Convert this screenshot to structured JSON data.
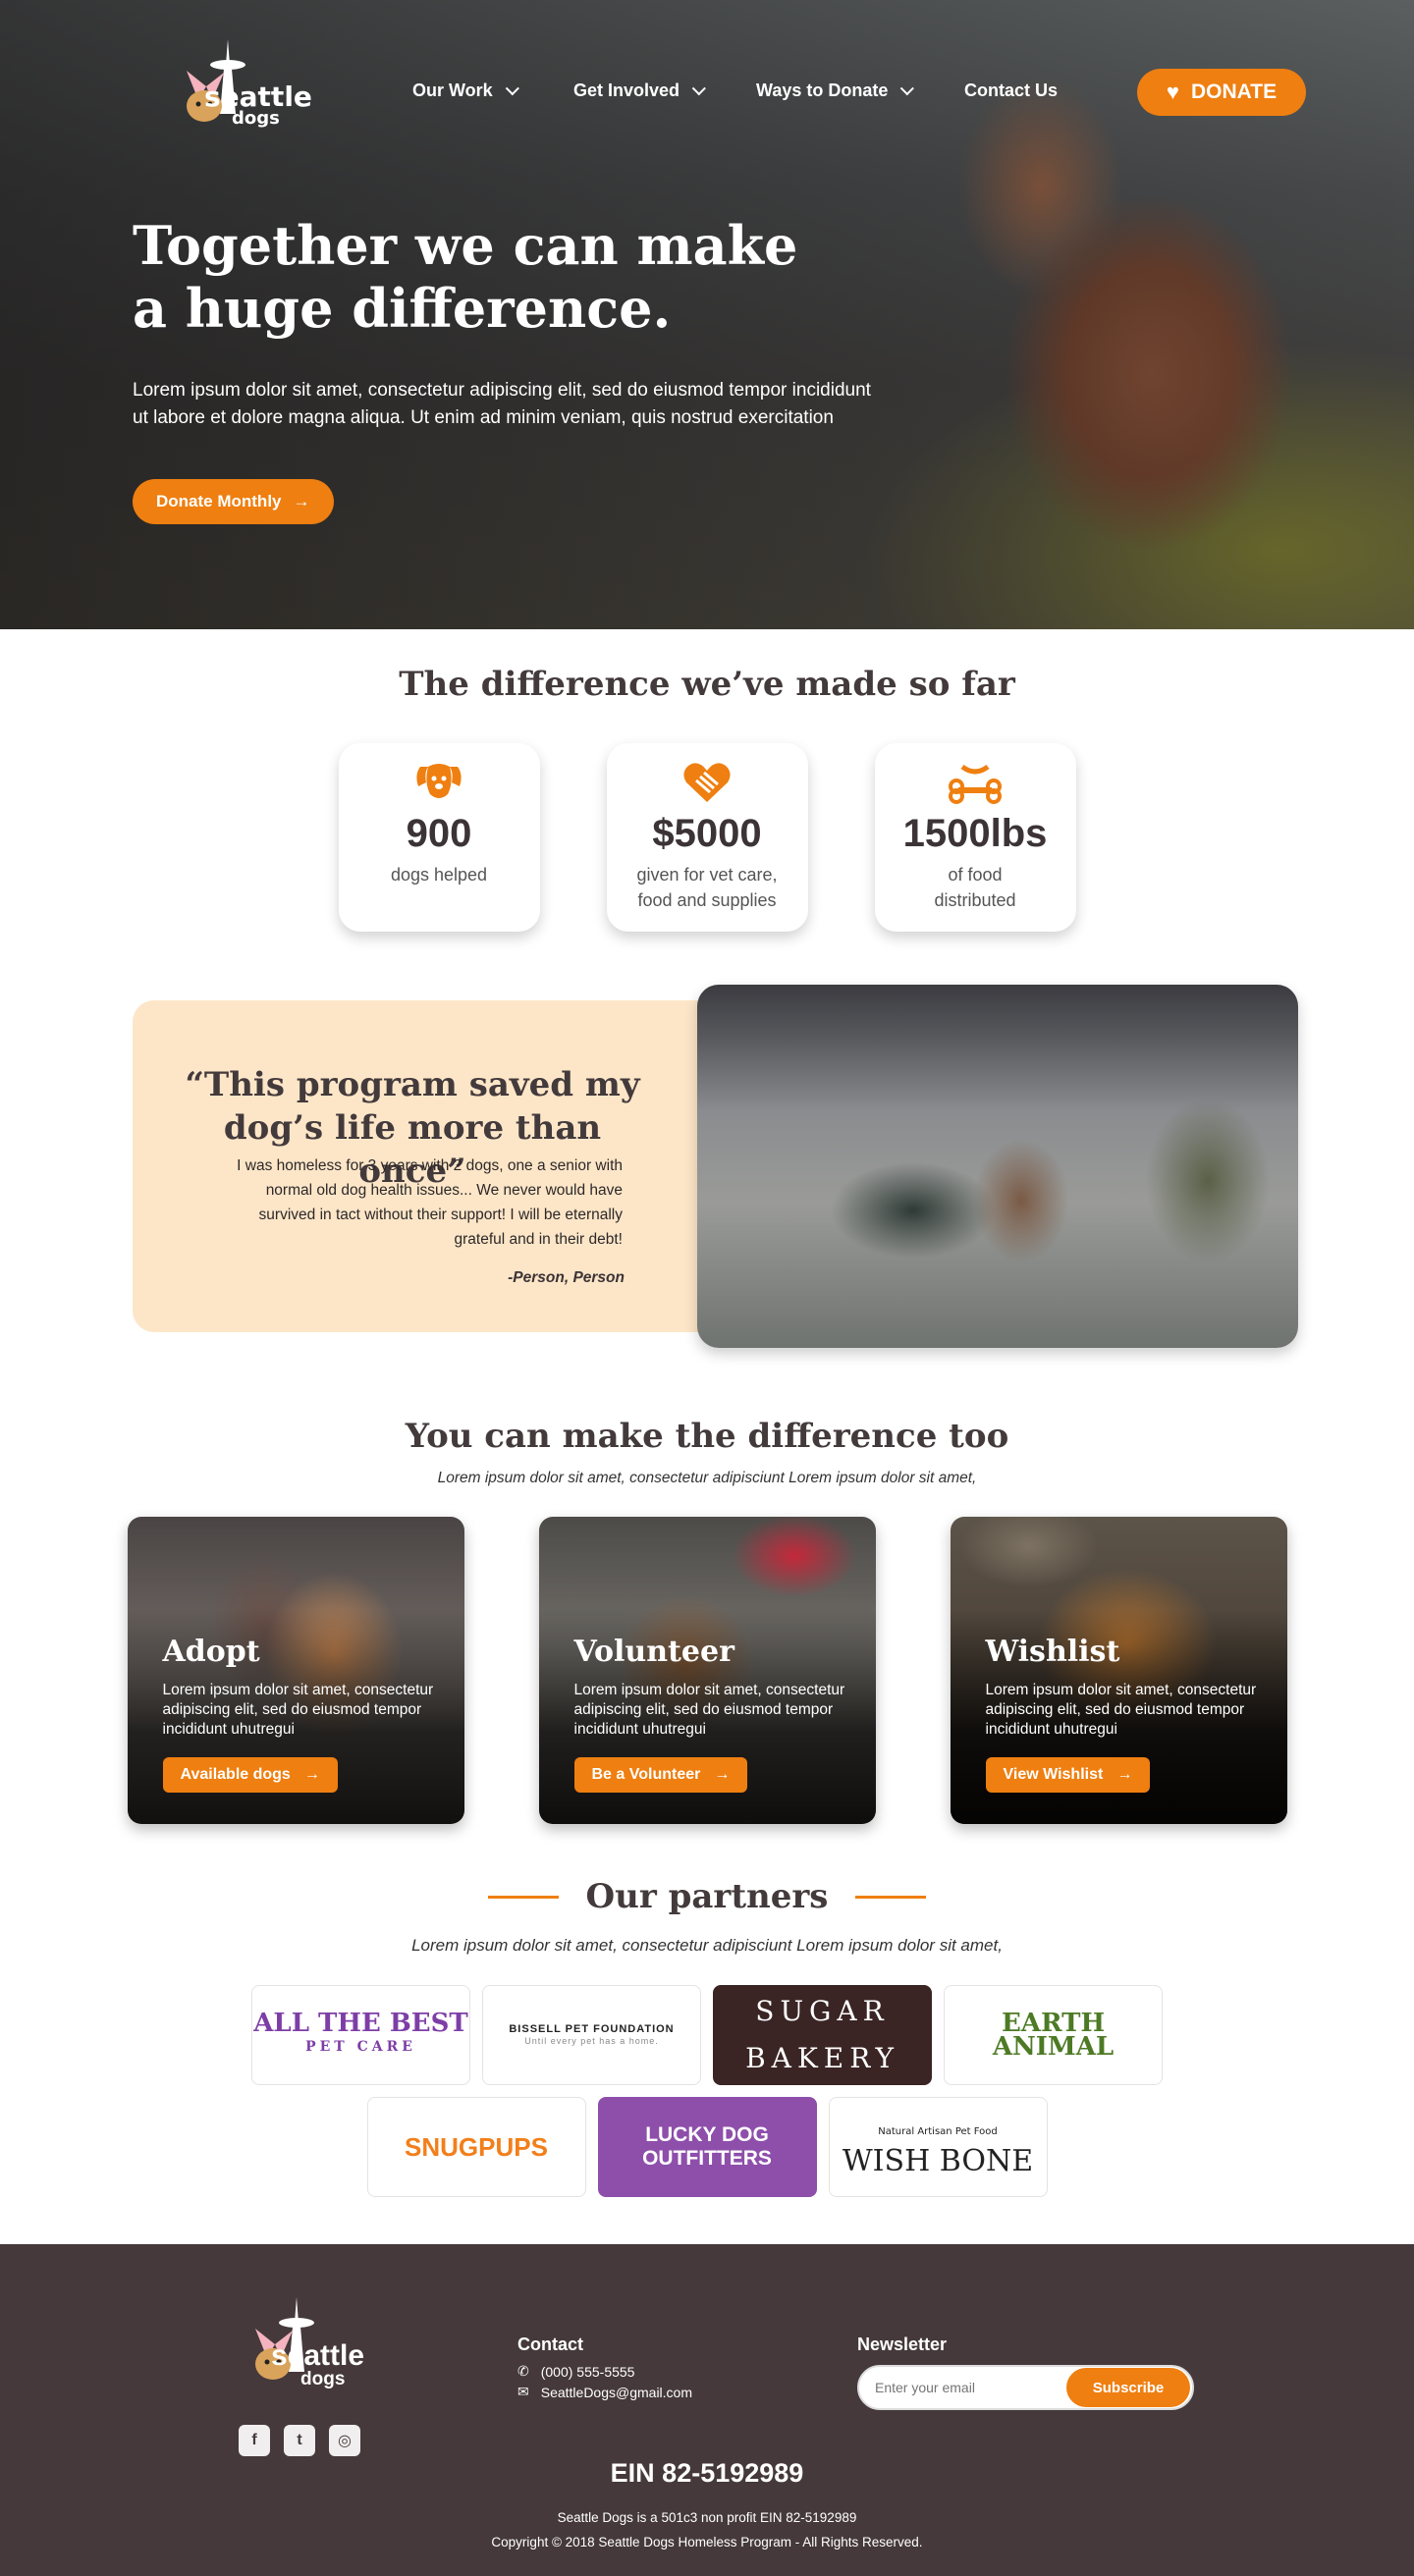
{
  "nav": {
    "logo_text_top": "seattle",
    "logo_text_bottom": "dogs",
    "items": [
      "Our Work",
      "Get Involved",
      "Ways to Donate",
      "Contact Us"
    ],
    "donate_label": "DONATE"
  },
  "hero": {
    "title_line1": "Together we can make",
    "title_line2": "a huge difference.",
    "text": "Lorem ipsum dolor sit amet, consectetur adipiscing elit, sed do eiusmod tempor incididunt ut labore et dolore magna aliqua. Ut enim ad minim veniam, quis nostrud exercitation",
    "button_label": "Donate Monthly"
  },
  "stats": {
    "title": "The difference we’ve made so far",
    "items": [
      {
        "value": "900",
        "label": "dogs helped",
        "icon": "dog-face-icon"
      },
      {
        "value": "$5000",
        "label": "given for vet care, food and supplies",
        "icon": "heart-hands-icon"
      },
      {
        "value": "1500lbs",
        "label": "of food distributed",
        "icon": "bone-icon"
      }
    ]
  },
  "testimonial": {
    "quote": "“This program saved my dog’s life more than once”",
    "body": "I was homeless for 3 years with 2 dogs, one a senior with normal old dog health issues... We never would have survived in tact without their support! I will be eternally grateful and in their debt!",
    "author": "-Person, Person"
  },
  "how": {
    "title": "You can make the difference too",
    "subtitle": "Lorem ipsum dolor sit amet, consectetur adipisciunt Lorem ipsum dolor sit amet,",
    "cards": [
      {
        "title": "Adopt",
        "text": "Lorem ipsum dolor sit amet, consectetur adipiscing elit, sed do eiusmod tempor incididunt  uhutregui",
        "button": "Available dogs"
      },
      {
        "title": "Volunteer",
        "text": "Lorem ipsum dolor sit amet, consectetur adipiscing elit, sed do eiusmod tempor incididunt  uhutregui",
        "button": "Be a Volunteer"
      },
      {
        "title": "Wishlist",
        "text": "Lorem ipsum dolor sit amet, consectetur adipiscing elit, sed do eiusmod tempor incididunt  uhutregui",
        "button": "View Wishlist"
      }
    ]
  },
  "partners": {
    "title": "Our partners",
    "subtitle": "Lorem ipsum dolor sit amet, consectetur adipisciunt Lorem ipsum dolor sit amet,",
    "logos": [
      {
        "name": "ALL THE BEST",
        "sub": "PET CARE"
      },
      {
        "name": "BISSELL PET FOUNDATION",
        "sub": "Until every pet has a home."
      },
      {
        "name": "SUGAR",
        "sub": "BAKERY"
      },
      {
        "name": "EARTH",
        "sub": "ANIMAL"
      },
      {
        "name": "SNUGPUPS",
        "sub": ""
      },
      {
        "name": "LUCKY DOG OUTFITTERS",
        "sub": ""
      },
      {
        "name": "WISH BONE",
        "sub": "Natural Artisan Pet Food"
      }
    ]
  },
  "footer": {
    "logo_text_top": "seattle",
    "logo_text_bottom": "dogs",
    "contact_title": "Contact",
    "phone": "(000) 555-5555",
    "email": "SeattleDogs@gmail.com",
    "newsletter_title": "Newsletter",
    "email_placeholder": "Enter your email",
    "subscribe_label": "Subscribe",
    "ein": "EIN 82-5192989",
    "nonprofit": "Seattle Dogs is a 501c3 non profit EIN 82-5192989",
    "copyright": "Copyright © 2018 Seattle Dogs Homeless Program - All Rights Reserved."
  },
  "colors": {
    "accent": "#ef7f10",
    "footer_bg": "#45393b",
    "quote_bg": "#fde6c8"
  }
}
